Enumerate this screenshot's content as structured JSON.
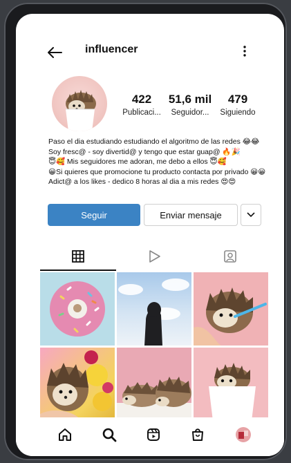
{
  "profile": {
    "username": "influencer",
    "stats": [
      {
        "value": "422",
        "label": "Publicaci..."
      },
      {
        "value": "51,6 mil",
        "label": "Seguidor..."
      },
      {
        "value": "479",
        "label": "Siguiendo"
      }
    ],
    "bio": [
      "Paso el dia estudiando estudiando el algoritmo de las redes 😂😂",
      "Soy fresc@ - soy divertid@ y tengo que estar guap@ 🔥🎉",
      "😇🥰 Mis seguidores me adoran, me debo a ellos 😇🥰",
      "😀Si quieres que promocione tu producto contacta por privado 😀😀",
      "Adict@ a los likes - dedico 8 horas al dia a mis redes 😍😍"
    ]
  },
  "actions": {
    "follow": "Seguir",
    "message": "Enviar mensaje"
  },
  "colors": {
    "accent": "#3b83c4"
  }
}
